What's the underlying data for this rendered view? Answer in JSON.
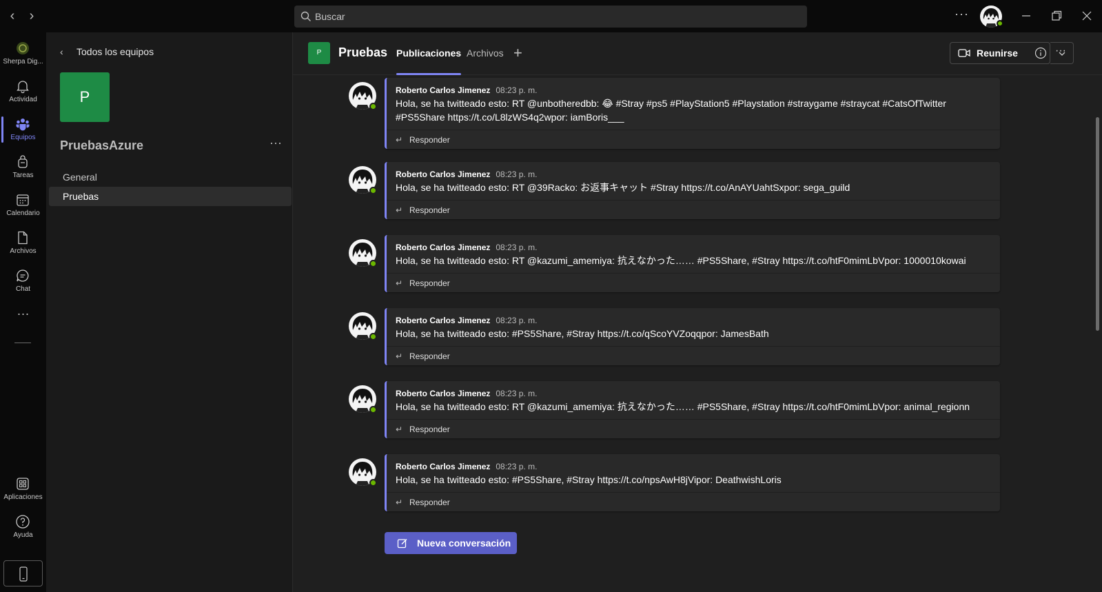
{
  "titlebar": {
    "search_placeholder": "Buscar"
  },
  "rail": {
    "org_label": "Sherpa Dig...",
    "items": [
      {
        "label": "Actividad",
        "icon": "bell-icon"
      },
      {
        "label": "Equipos",
        "icon": "teams-icon",
        "active": true
      },
      {
        "label": "Tareas",
        "icon": "tasks-icon"
      },
      {
        "label": "Calendario",
        "icon": "calendar-icon"
      },
      {
        "label": "Archivos",
        "icon": "file-icon"
      },
      {
        "label": "Chat",
        "icon": "chat-icon"
      }
    ],
    "more": "···",
    "apps_label": "Aplicaciones",
    "help_label": "Ayuda"
  },
  "team_panel": {
    "back_label": "Todos los equipos",
    "tile_letter": "P",
    "team_name": "PruebasAzure",
    "channels": [
      {
        "label": "General",
        "active": false
      },
      {
        "label": "Pruebas",
        "active": true
      }
    ]
  },
  "channel_header": {
    "tile_letter": "P",
    "title": "Pruebas",
    "tabs": [
      {
        "label": "Publicaciones",
        "active": true
      },
      {
        "label": "Archivos",
        "active": false
      }
    ],
    "meet_label": "Reunirse"
  },
  "posts": [
    {
      "author": "Roberto Carlos Jimenez",
      "time": "08:23 p. m.",
      "message": "Hola, se ha twitteado esto: RT @unbotheredbb: 😂 #Stray #ps5 #PlayStation5 #Playstation #straygame #straycat #CatsOfTwitter #PS5Share https://t.co/L8lzWS4q2wpor: iamBoris___",
      "reply": "Responder"
    },
    {
      "author": "Roberto Carlos Jimenez",
      "time": "08:23 p. m.",
      "message": "Hola, se ha twitteado esto: RT @39Racko: お返事キャット #Stray https://t.co/AnAYUahtSxpor: sega_guild",
      "reply": "Responder"
    },
    {
      "author": "Roberto Carlos Jimenez",
      "time": "08:23 p. m.",
      "message": "Hola, se ha twitteado esto: RT @kazumi_amemiya: 抗えなかった…… #PS5Share, #Stray https://t.co/htF0mimLbVpor: 1000010kowai",
      "reply": "Responder"
    },
    {
      "author": "Roberto Carlos Jimenez",
      "time": "08:23 p. m.",
      "message": "Hola, se ha twitteado esto: #PS5Share, #Stray https://t.co/qScoYVZoqqpor: JamesBath",
      "reply": "Responder"
    },
    {
      "author": "Roberto Carlos Jimenez",
      "time": "08:23 p. m.",
      "message": "Hola, se ha twitteado esto: RT @kazumi_amemiya: 抗えなかった…… #PS5Share, #Stray https://t.co/htF0mimLbVpor: animal_regionn",
      "reply": "Responder"
    },
    {
      "author": "Roberto Carlos Jimenez",
      "time": "08:23 p. m.",
      "message": "Hola, se ha twitteado esto: #PS5Share, #Stray https://t.co/npsAwH8jVipor: DeathwishLoris",
      "reply": "Responder"
    }
  ],
  "new_conversation_label": "Nueva conversación",
  "colors": {
    "accent": "#7f85f5",
    "button": "#5b5fc7",
    "team_tile": "#1e8b45",
    "presence": "#6bb700"
  }
}
